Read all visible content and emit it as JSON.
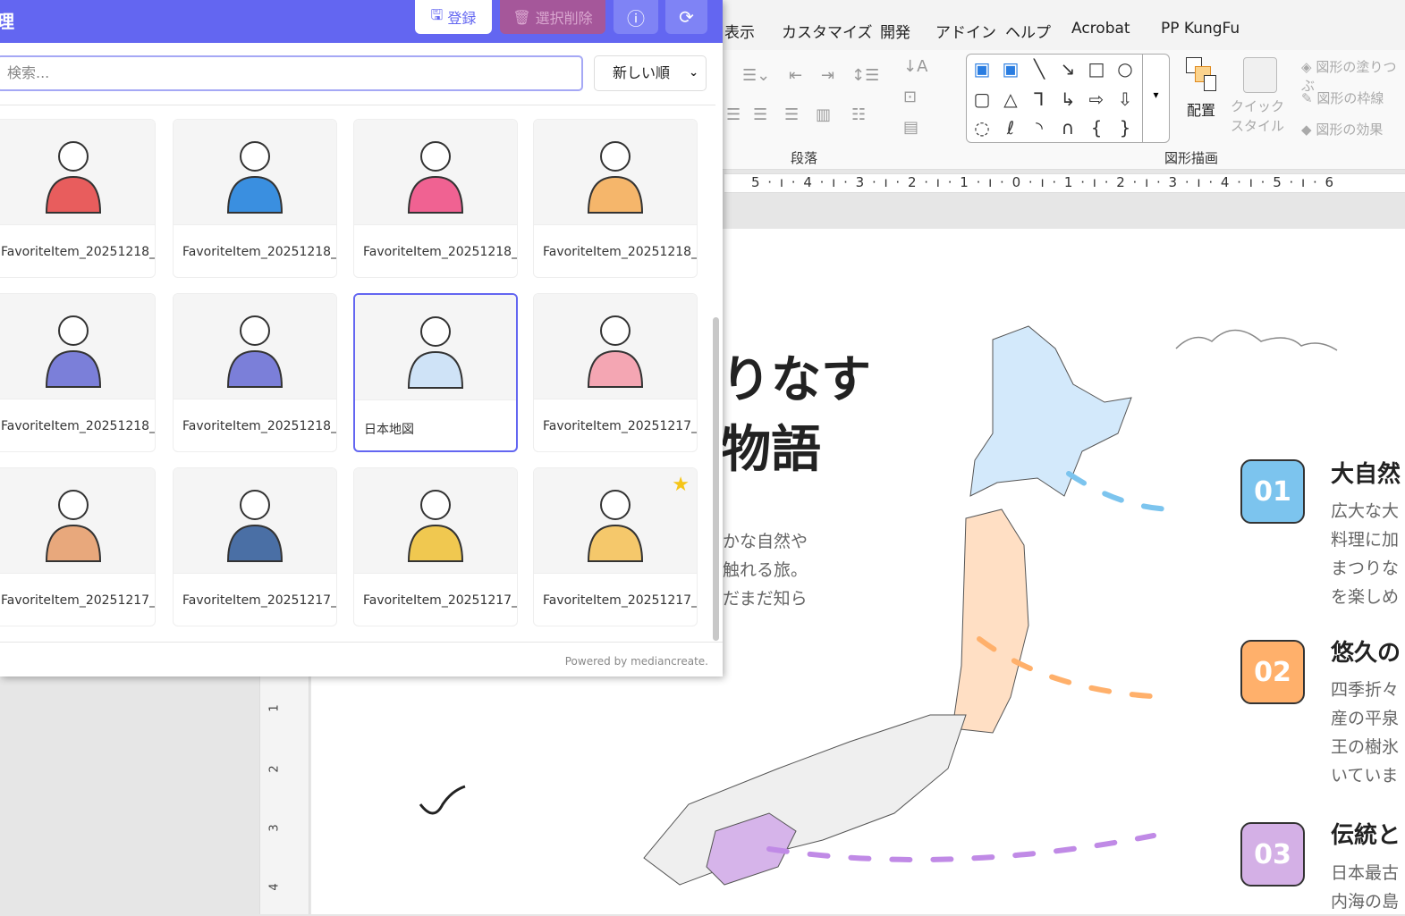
{
  "panel": {
    "title": "理",
    "register": "登録",
    "delete_selected": "選択削除",
    "search_placeholder": "検索...",
    "sort": "新しい順",
    "footer": "Powered by mediancreate.",
    "items": [
      {
        "name": "FavoriteItem_20251218_",
        "color": "#e85d5d"
      },
      {
        "name": "FavoriteItem_20251218_",
        "color": "#3a8fe0"
      },
      {
        "name": "FavoriteItem_20251218_",
        "color": "#f06292"
      },
      {
        "name": "FavoriteItem_20251218_",
        "color": "#f5b66b"
      },
      {
        "name": "FavoriteItem_20251218_",
        "color": "#7b7fd9"
      },
      {
        "name": "FavoriteItem_20251218_",
        "color": "#7b7fd9"
      },
      {
        "name": "日本地図",
        "color": "#cfe3f7",
        "selected": true
      },
      {
        "name": "FavoriteItem_20251217_",
        "color": "#f4a6b3"
      },
      {
        "name": "FavoriteItem_20251217_",
        "color": "#e8a87c"
      },
      {
        "name": "FavoriteItem_20251217_",
        "color": "#4a6fa5"
      },
      {
        "name": "FavoriteItem_20251217_",
        "color": "#f0c850"
      },
      {
        "name": "FavoriteItem_20251217_",
        "color": "#f5c86b",
        "starred": true
      }
    ]
  },
  "ppt": {
    "menu": [
      "表示",
      "カスタマイズ",
      "開発",
      "アドイン",
      "ヘルプ",
      "Acrobat",
      "PP KungFu"
    ],
    "group_paragraph": "段落",
    "group_drawing": "図形描画",
    "arrange": "配置",
    "quick_style": "クイック\nスタイル",
    "shape_fill": "図形の塗りつぶ",
    "shape_outline": "図形の枠線",
    "shape_effect": "図形の効果",
    "ruler": "5 · ı · 4 · ı · 3 · ı · 2 · ı · 1 · ı · 0 · ı · 1 · ı · 2 · ı · 3 · ı · 4 · ı · 5 · ı · 6",
    "vruler": [
      "1",
      "2",
      "3",
      "4"
    ]
  },
  "slide": {
    "title1": "りなす",
    "title2": "物語",
    "para": [
      "かな自然や",
      "触れる旅。",
      "だまだ知ら"
    ],
    "features": [
      {
        "num": "01",
        "title": "大自然",
        "text": "広大な大\n料理に加\nまつりな\nを楽しめ",
        "color": "#7cc4ee"
      },
      {
        "num": "02",
        "title": "悠久の",
        "text": "四季折々\n産の平泉\n王の樹氷\nいていま",
        "color": "#ffb06b"
      },
      {
        "num": "03",
        "title": "伝統と",
        "text": "日本最古\n内海の島",
        "color": "#d4b0e6"
      }
    ]
  }
}
